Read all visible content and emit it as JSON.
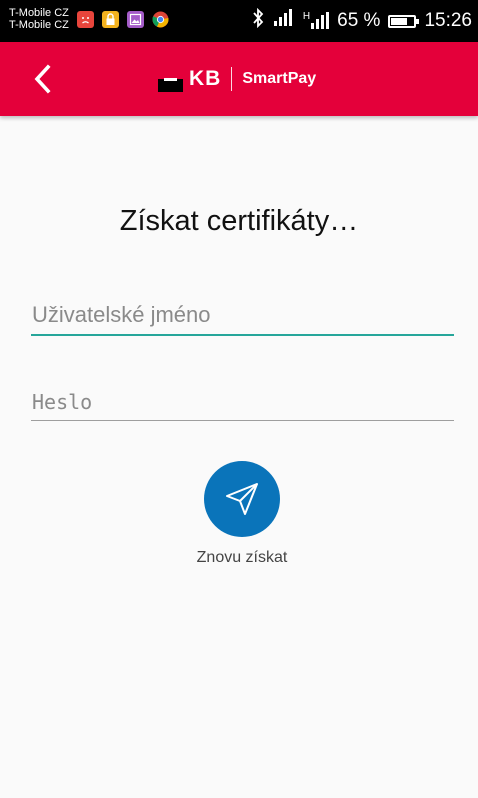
{
  "status_bar": {
    "carrier_1": "T-Mobile CZ",
    "carrier_2": "T-Mobile CZ",
    "network_type": "H",
    "battery": "65 %",
    "time": "15:26",
    "icons": [
      "sad-face-icon",
      "lock-icon",
      "gallery-icon",
      "chrome-icon",
      "bluetooth-icon",
      "signal-icon",
      "battery-icon"
    ]
  },
  "app_bar": {
    "logo_kb": "KB",
    "logo_app": "SmartPay",
    "brand_color": "#e4003a"
  },
  "main": {
    "title": "Získat certifikáty…",
    "username": {
      "value": "",
      "placeholder": "Uživatelské jméno",
      "accent": "#26a69a"
    },
    "password": {
      "value": "",
      "placeholder": "Heslo"
    },
    "action": {
      "label": "Znovu získat",
      "icon": "send-icon",
      "color": "#0a74ba"
    }
  }
}
